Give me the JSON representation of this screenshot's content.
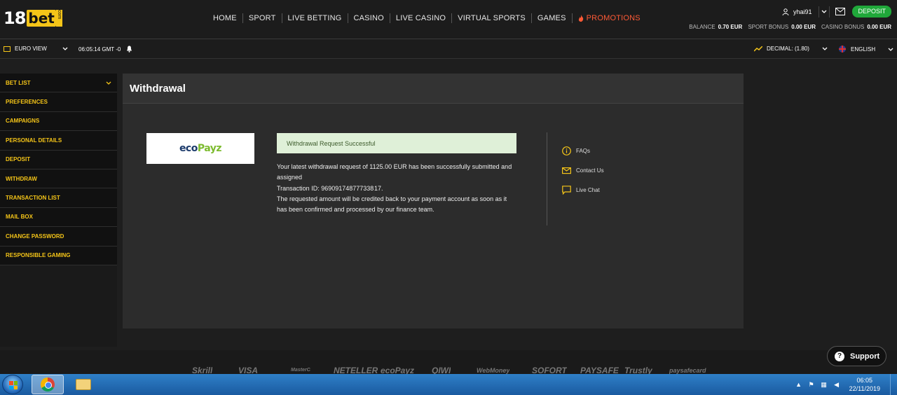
{
  "header": {
    "logo_number": "18",
    "logo_word": "bet",
    "logo_tld": "com",
    "nav": [
      "HOME",
      "SPORT",
      "LIVE BETTING",
      "CASINO",
      "LIVE CASINO",
      "VIRTUAL SPORTS",
      "GAMES",
      "PROMOTIONS"
    ],
    "username": "yhai91",
    "deposit_label": "DEPOSIT",
    "balances": {
      "balance_label": "BALANCE",
      "balance_value": "0.70 EUR",
      "sport_label": "SPORT BONUS",
      "sport_value": "0.00 EUR",
      "casino_label": "CASINO BONUS",
      "casino_value": "0.00 EUR"
    }
  },
  "subbar": {
    "view": "EURO VIEW",
    "clock": "06:05:14 GMT -0",
    "odds": "DECIMAL: (1.80)",
    "language": "ENGLISH"
  },
  "sidebar": {
    "items": [
      "BET LIST",
      "PREFERENCES",
      "CAMPAIGNS",
      "PERSONAL DETAILS",
      "DEPOSIT",
      "WITHDRAW",
      "TRANSACTION LIST",
      "MAIL BOX",
      "CHANGE PASSWORD",
      "RESPONSIBLE GAMING"
    ]
  },
  "main": {
    "title": "Withdrawal",
    "payment_logo_a": "eco",
    "payment_logo_b": "Payz",
    "success_text": "Withdrawal Request Successful",
    "message_line1": "Your latest withdrawal request of 1125.00 EUR has been successfully submitted and assigned",
    "message_line2": "Transaction ID: 969091748777338 17.",
    "message_line3": "The requested amount will be credited back to your payment account as soon as it has been confirmed and processed by our finance team.",
    "help": [
      "FAQs",
      "Contact Us",
      "Live Chat"
    ]
  },
  "footer": {
    "payment_logos": [
      "Skrill",
      "VISA",
      "MasterCard",
      "NETELLER",
      "ecoPayz",
      "QIWI",
      "WebMoney",
      "SOFORT",
      "PAYSAFE",
      "Trustly",
      "paysafecard"
    ],
    "support_label": "Support"
  },
  "taskbar": {
    "time": "06:05",
    "date": "22/11/2019"
  },
  "colors": {
    "accent_yellow": "#f5c518",
    "deposit_green": "#20a83a",
    "promo_red": "#ff5a36",
    "success_bg": "#dff0d8"
  }
}
